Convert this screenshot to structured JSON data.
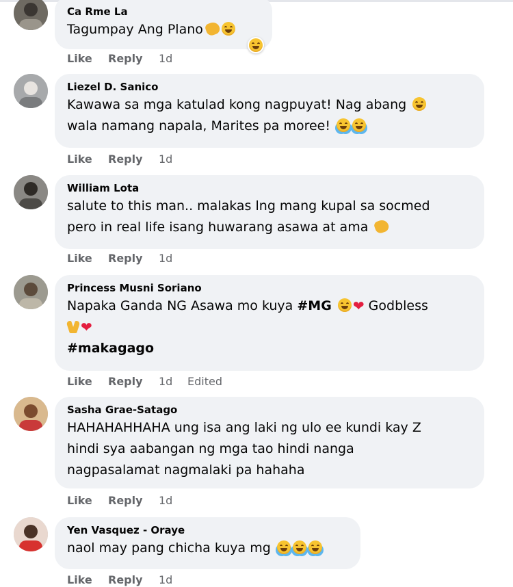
{
  "actions": {
    "like": "Like",
    "reply": "Reply"
  },
  "comments": [
    {
      "author": "Ca Rme La",
      "lines": [
        "Tagumpay Ang Plano"
      ],
      "time": "1d",
      "edited": ""
    },
    {
      "author": "Liezel D. Sanico",
      "lines": [
        "Kawawa sa mga katulad kong nagpuyat! Nag abang",
        "wala namang napala, Marites pa moree!"
      ],
      "time": "1d",
      "edited": ""
    },
    {
      "author": "William Lota",
      "lines": [
        "salute to this man.. malakas lng mang kupal sa socmed",
        "pero in real life isang huwarang asawa at ama"
      ],
      "time": "1d",
      "edited": ""
    },
    {
      "author": "Princess Musni Soriano",
      "lines": [
        "Napaka Ganda NG Asawa mo kuya",
        "#MG",
        "Godbless",
        "#makagago"
      ],
      "time": "1d",
      "edited": "Edited"
    },
    {
      "author": "Sasha Grae-Satago",
      "lines": [
        "HAHAHAHHAHA ung isa ang laki ng ulo ee kundi kay Z",
        "hindi sya aabangan ng mga tao hindi nanga",
        "nagpasalamat nagmalaki pa hahaha"
      ],
      "time": "1d",
      "edited": ""
    },
    {
      "author": "Yen Vasquez - Oraye",
      "lines": [
        "naol may pang chicha kuya mg"
      ],
      "time": "1d",
      "edited": ""
    }
  ]
}
